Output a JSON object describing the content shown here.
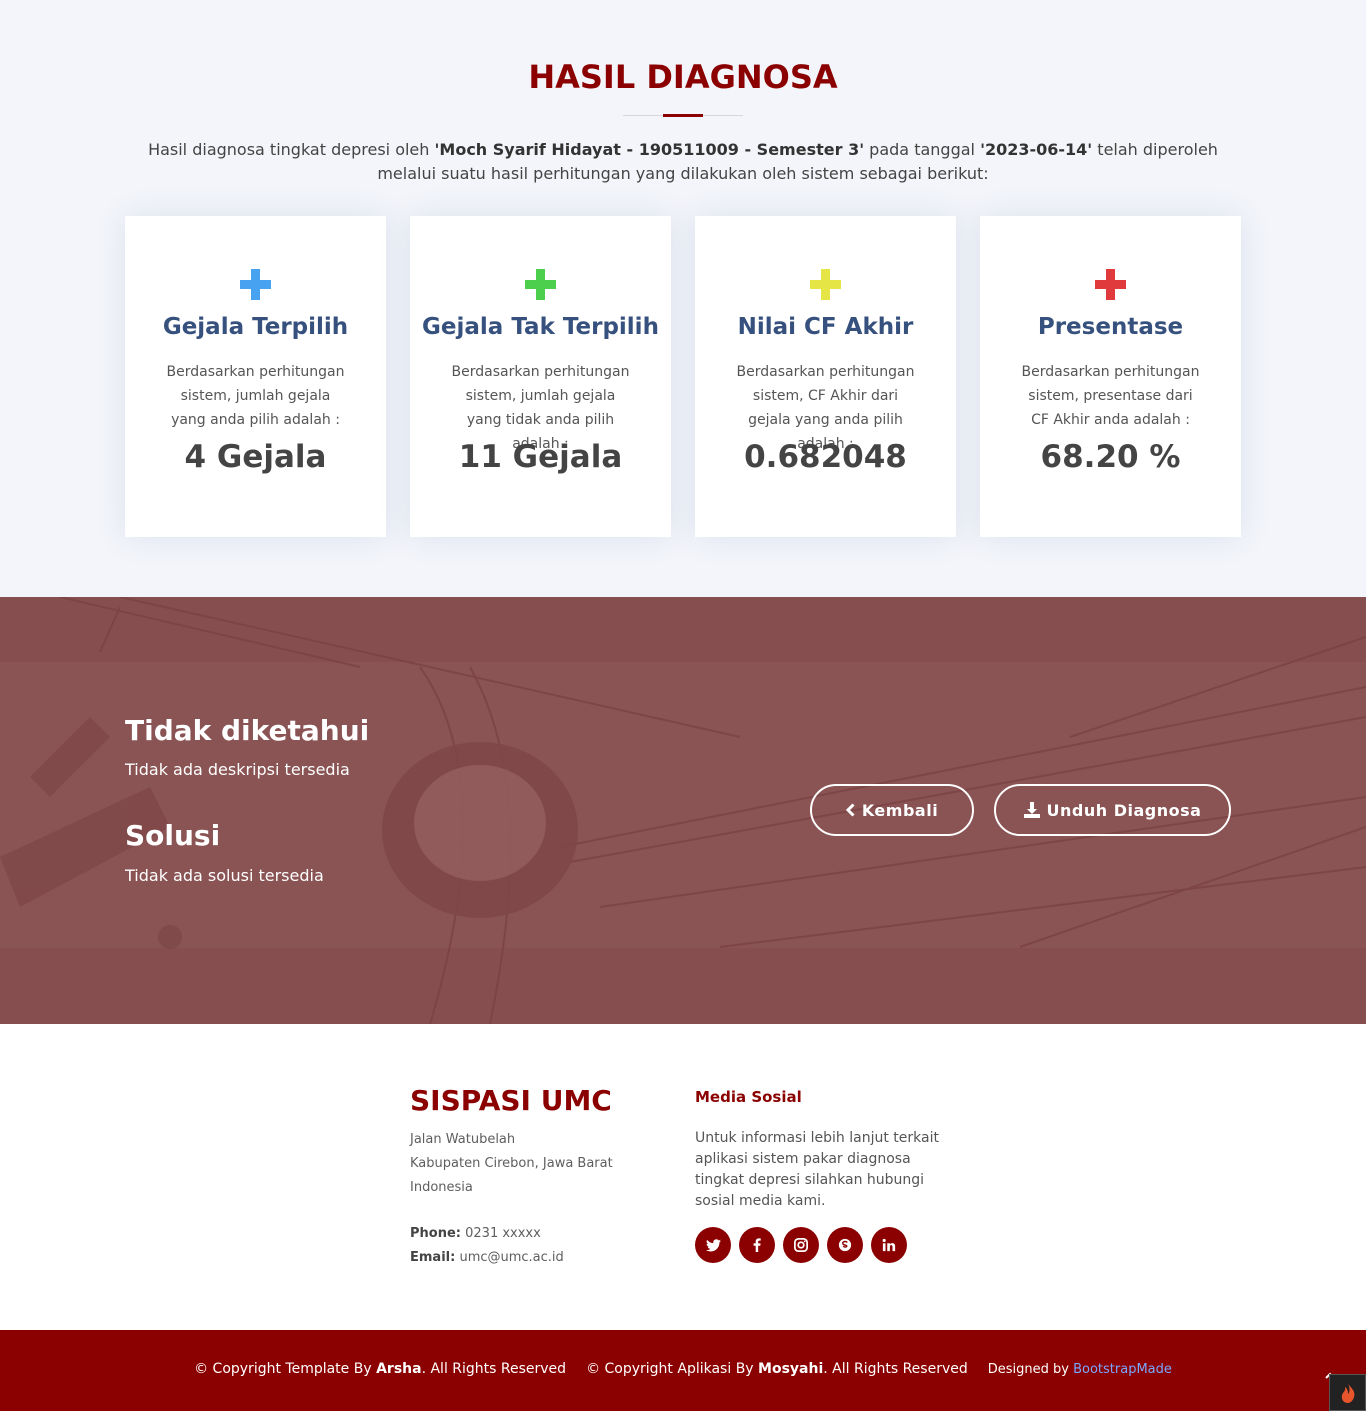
{
  "result": {
    "title": "HASIL DIAGNOSA",
    "intro_prefix": "Hasil diagnosa tingkat depresi oleh ",
    "intro_name": "'Moch Syarif Hidayat - 190511009 - Semester 3'",
    "intro_middle": " pada tanggal ",
    "intro_date": "'2023-06-14'",
    "intro_suffix": " telah diperoleh melalui suatu hasil perhitungan yang dilakukan oleh sistem sebagai berikut:",
    "cards": [
      {
        "icon": "plus-icon",
        "color": "#47a2f2",
        "title": "Gejala Terpilih",
        "desc": "Berdasarkan perhitungan sistem, jumlah gejala yang anda pilih adalah :",
        "value": "4 Gejala"
      },
      {
        "icon": "plus-icon",
        "color": "#4ccf4c",
        "title": "Gejala Tak Terpilih",
        "desc": "Berdasarkan perhitungan sistem, jumlah gejala yang tidak anda pilih adalah :",
        "value": "11 Gejala"
      },
      {
        "icon": "plus-icon",
        "color": "#e5e545",
        "title": "Nilai CF Akhir",
        "desc": "Berdasarkan perhitungan sistem, CF Akhir dari gejala yang anda pilih adalah :",
        "value": "0.682048"
      },
      {
        "icon": "plus-icon",
        "color": "#e03a3c",
        "title": "Presentase",
        "desc": "Berdasarkan perhitungan sistem, presentase dari CF Akhir anda adalah :",
        "value": "68.20 %"
      }
    ]
  },
  "diagnosis": {
    "description_title": "Tidak diketahui",
    "description_text": "Tidak ada deskripsi tersedia",
    "solution_title": "Solusi",
    "solution_text": "Tidak ada solusi tersedia",
    "back_button": "Kembali",
    "download_button": "Unduh Diagnosa"
  },
  "footer": {
    "brand": "SISPASI UMC",
    "address": [
      "Jalan Watubelah",
      "Kabupaten Cirebon, Jawa Barat",
      "Indonesia"
    ],
    "phone_label": "Phone:",
    "phone": "0231 xxxxx",
    "email_label": "Email:",
    "email": "umc@umc.ac.id",
    "social_title": "Media Sosial",
    "social_text": "Untuk informasi lebih lanjut terkait aplikasi sistem pakar diagnosa tingkat depresi silahkan hubungi sosial media kami.",
    "social_icons": [
      "twitter-icon",
      "facebook-icon",
      "instagram-icon",
      "skype-icon",
      "linkedin-icon"
    ]
  },
  "copyright": {
    "template_prefix": "© Copyright Template By ",
    "template_author": "Arsha",
    "template_suffix": ". All Rights Reserved",
    "app_prefix": "© Copyright Aplikasi By ",
    "app_author": "Mosyahi",
    "app_suffix": ". All Rights Reserved",
    "designed_by": "Designed by ",
    "designer": "BootstrapMade"
  },
  "colors": {
    "brand": "#8b0000",
    "cta_overlay": "#874e4f",
    "card_title": "#37517e",
    "link": "#7aa7ff"
  }
}
